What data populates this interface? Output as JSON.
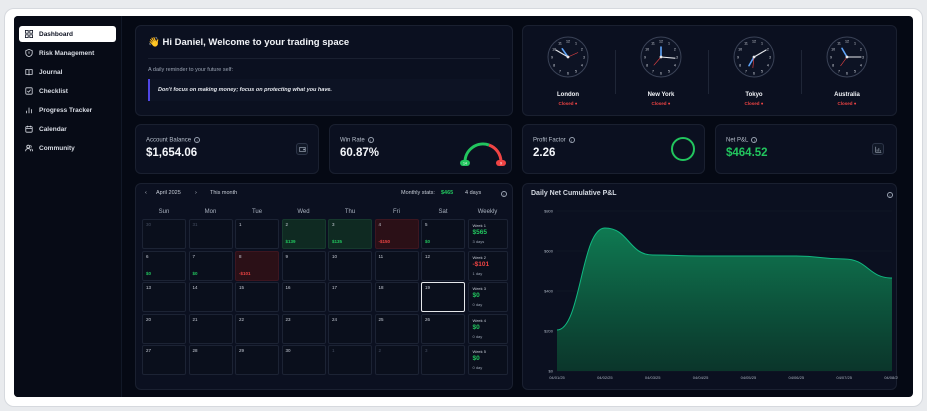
{
  "sidebar": {
    "items": [
      {
        "label": "Dashboard",
        "icon": "grid-icon",
        "active": true
      },
      {
        "label": "Risk Management",
        "icon": "shield-icon"
      },
      {
        "label": "Journal",
        "icon": "book-icon"
      },
      {
        "label": "Checklist",
        "icon": "checkbox-icon"
      },
      {
        "label": "Progress Tracker",
        "icon": "bar-chart-icon"
      },
      {
        "label": "Calendar",
        "icon": "calendar-icon"
      },
      {
        "label": "Community",
        "icon": "users-icon"
      }
    ]
  },
  "welcome": {
    "emoji": "👋",
    "title": "Hi Daniel, Welcome to your trading space",
    "reminder": "A daily reminder to your future self:",
    "quote": "Don't focus on making money; focus on protecting what you have."
  },
  "clocks": [
    {
      "city": "London",
      "status": "Closed"
    },
    {
      "city": "New York",
      "status": "Closed"
    },
    {
      "city": "Tokyo",
      "status": "Closed"
    },
    {
      "city": "Australia",
      "status": "Closed"
    }
  ],
  "stats": {
    "account_balance": {
      "label": "Account Balance",
      "value": "$1,654.06"
    },
    "win_rate": {
      "label": "Win Rate",
      "value": "60.87%",
      "wins": 14,
      "losses": 9
    },
    "profit_factor": {
      "label": "Profit Factor",
      "value": "2.26"
    },
    "net_pnl": {
      "label": "Net P&L",
      "value": "$464.52"
    }
  },
  "calendar": {
    "month": "April 2025",
    "this_month": "This month",
    "monthly_stats_label": "Monthly stats:",
    "monthly_stats_value": "$465",
    "monthly_days": "4 days",
    "prev": "‹",
    "next": "›",
    "days_of_week": [
      "Sun",
      "Mon",
      "Tue",
      "Wed",
      "Thu",
      "Fri",
      "Sat"
    ],
    "weekly_label": "Weekly",
    "rows": [
      [
        {
          "d": "30",
          "m": true
        },
        {
          "d": "31",
          "m": true
        },
        {
          "d": "1"
        },
        {
          "d": "2",
          "p": "$139",
          "s": "g"
        },
        {
          "d": "3",
          "p": "$135",
          "s": "g"
        },
        {
          "d": "4",
          "p": "-$150",
          "s": "r"
        },
        {
          "d": "5",
          "p": "$0"
        }
      ],
      [
        {
          "d": "6",
          "p": "$0"
        },
        {
          "d": "7",
          "p": "$0"
        },
        {
          "d": "8",
          "p": "-$101",
          "s": "r"
        },
        {
          "d": "9"
        },
        {
          "d": "10"
        },
        {
          "d": "11"
        },
        {
          "d": "12"
        }
      ],
      [
        {
          "d": "13"
        },
        {
          "d": "14"
        },
        {
          "d": "15"
        },
        {
          "d": "16"
        },
        {
          "d": "17"
        },
        {
          "d": "18"
        },
        {
          "d": "19",
          "today": true
        }
      ],
      [
        {
          "d": "20"
        },
        {
          "d": "21"
        },
        {
          "d": "22"
        },
        {
          "d": "23"
        },
        {
          "d": "24"
        },
        {
          "d": "25"
        },
        {
          "d": "26"
        }
      ],
      [
        {
          "d": "27"
        },
        {
          "d": "28"
        },
        {
          "d": "29"
        },
        {
          "d": "30"
        },
        {
          "d": "1",
          "m": true
        },
        {
          "d": "2",
          "m": true
        },
        {
          "d": "3",
          "m": true
        }
      ]
    ],
    "weeks": [
      {
        "label": "Week 1",
        "value": "$565",
        "days": "3 days",
        "s": "g"
      },
      {
        "label": "Week 2",
        "value": "-$101",
        "days": "1 day",
        "s": "r"
      },
      {
        "label": "Week 3",
        "value": "$0",
        "days": "0 day",
        "s": "g"
      },
      {
        "label": "Week 4",
        "value": "$0",
        "days": "0 day",
        "s": "g"
      },
      {
        "label": "Week 5",
        "value": "$0",
        "days": "0 day",
        "s": "g"
      }
    ]
  },
  "chart_data": {
    "type": "area",
    "title": "Daily Net Cumulative P&L",
    "x": [
      "04/01/25",
      "04/02/25",
      "04/03/25",
      "04/04/25",
      "04/05/25",
      "04/06/25",
      "04/07/25",
      "04/08/25"
    ],
    "y_ticks": [
      "$0",
      "$200",
      "$400",
      "$600",
      "$800"
    ],
    "ylim": [
      0,
      800
    ],
    "series": [
      {
        "values": [
          205,
          715,
          580,
          575,
          575,
          575,
          560,
          465
        ]
      }
    ],
    "colors": {
      "fill": "#0f7a52",
      "line": "#10b981"
    }
  }
}
